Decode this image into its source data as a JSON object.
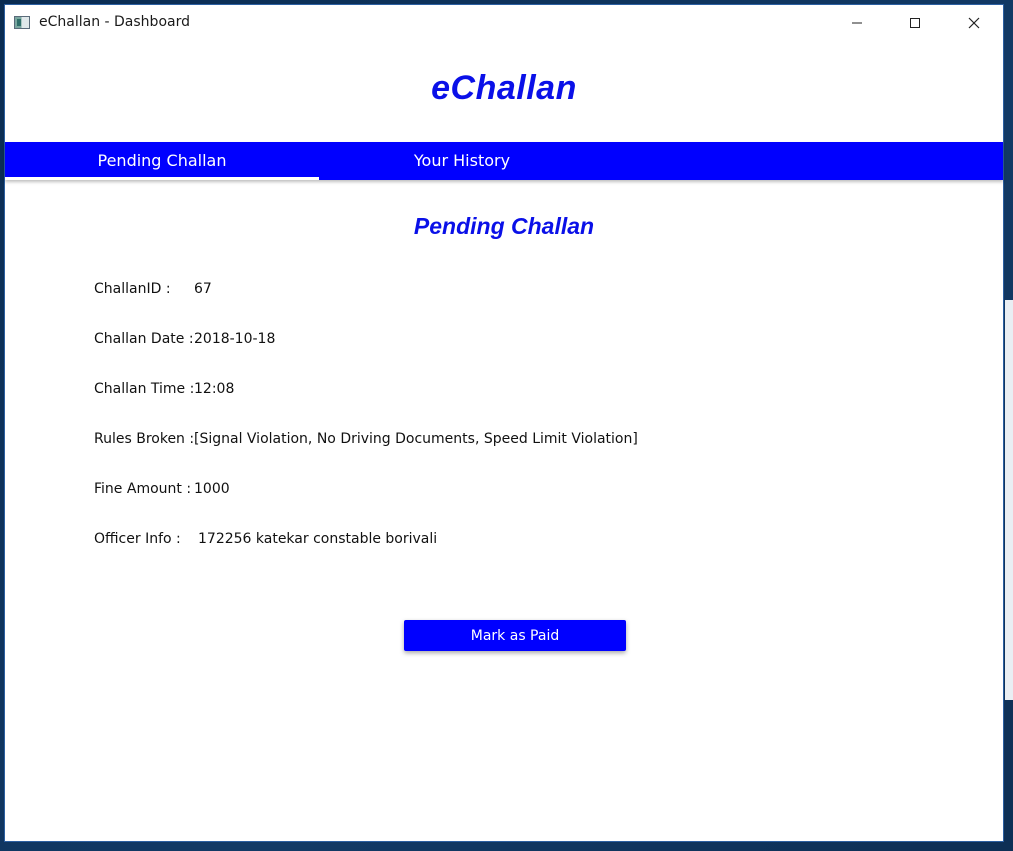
{
  "window": {
    "title": "eChallan - Dashboard"
  },
  "app": {
    "heading": "eChallan"
  },
  "tabs": [
    {
      "label": "Pending Challan",
      "selected": true
    },
    {
      "label": "Your History",
      "selected": false
    }
  ],
  "pending": {
    "heading": "Pending Challan",
    "fields": [
      {
        "label": "ChallanID :",
        "value": "67"
      },
      {
        "label": "Challan Date :",
        "value": "2018-10-18"
      },
      {
        "label": "Challan Time :",
        "value": "12:08"
      },
      {
        "label": "Rules Broken :",
        "value": "[Signal Violation, No Driving Documents, Speed Limit Violation]"
      },
      {
        "label": "Fine Amount :",
        "value": "1000"
      },
      {
        "label": "Officer Info :",
        "value": "172256 katekar constable borivali"
      }
    ],
    "button_label": "Mark as Paid"
  },
  "colors": {
    "accent": "#0000ff",
    "heading": "#0a10e8"
  },
  "icons": {
    "app": "app-window-icon",
    "minimize": "minimize-icon",
    "maximize": "maximize-icon",
    "close": "close-icon"
  }
}
